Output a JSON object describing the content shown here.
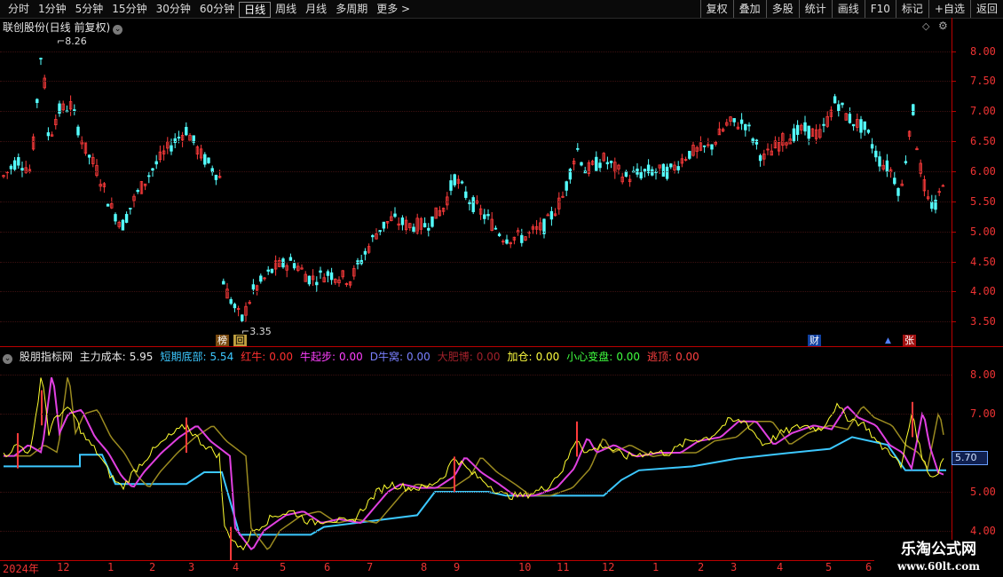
{
  "toolbar": {
    "left_items": [
      "分时",
      "1分钟",
      "5分钟",
      "15分钟",
      "30分钟",
      "60分钟",
      "日线",
      "周线",
      "月线",
      "多周期",
      "更多 >"
    ],
    "active_index": 6,
    "right_buttons": [
      "复权",
      "叠加",
      "多股",
      "统计",
      "画线",
      "F10",
      "标记",
      "+自选",
      "返回"
    ]
  },
  "stock_title": "联创股份(日线 前复权)",
  "main_axis": {
    "labels": [
      "8.00",
      "7.50",
      "7.00",
      "6.50",
      "6.00",
      "5.50",
      "5.00",
      "4.50",
      "4.00",
      "3.50"
    ]
  },
  "sub_axis": {
    "labels": [
      "8.00",
      "7.00",
      "5.00",
      "4.00"
    ]
  },
  "current_value": "5.70",
  "annotations": {
    "high": "8.26",
    "low": "3.35",
    "badges": [
      "榜",
      "回",
      "财",
      "张"
    ]
  },
  "indicator": {
    "name": "股朋指标网",
    "items": [
      {
        "label": "主力成本:",
        "value": "5.95",
        "color": "#e8e8e8"
      },
      {
        "label": "短期底部:",
        "value": "5.54",
        "color": "#3cc8ff"
      },
      {
        "label": "红牛:",
        "value": "0.00",
        "color": "#ff3030"
      },
      {
        "label": "牛起步:",
        "value": "0.00",
        "color": "#ff40ff"
      },
      {
        "label": "D牛窝:",
        "value": "0.00",
        "color": "#7a80ff"
      },
      {
        "label": "大肥博:",
        "value": "0.00",
        "color": "#a0202a"
      },
      {
        "label": "加仓:",
        "value": "0.00",
        "color": "#ffff40"
      },
      {
        "label": "小心变盘:",
        "value": "0.00",
        "color": "#40ff40"
      },
      {
        "label": "逃顶:",
        "value": "0.00",
        "color": "#ff4040"
      }
    ]
  },
  "x_axis": {
    "labels": [
      "2024年",
      "12",
      "1",
      "2",
      "3",
      "4",
      "5",
      "6",
      "7",
      "8",
      "9",
      "10",
      "11",
      "12",
      "1",
      "2",
      "3",
      "4",
      "5",
      "6"
    ]
  },
  "watermark": {
    "line1": "乐淘公式网",
    "line2": "www.60lt.com"
  },
  "colors": {
    "up": "#ff3b3b",
    "down": "#54ffff",
    "axis": "#b00000",
    "base_line": "#3cc8ff",
    "ma_magenta": "#e040e0",
    "ma_olive": "#9a8a20",
    "ma_yellow": "#ffff30"
  }
}
